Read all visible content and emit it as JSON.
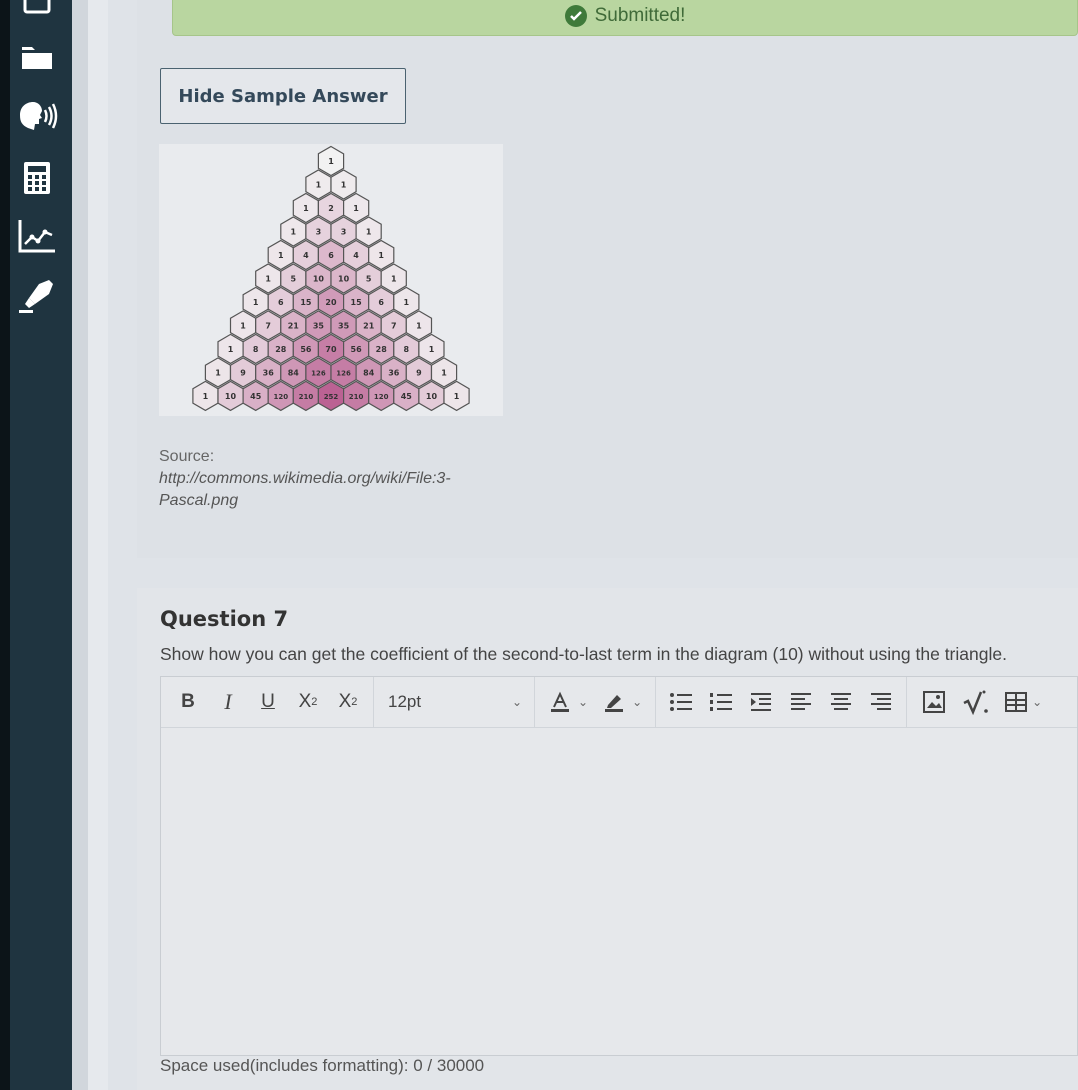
{
  "banner": {
    "text": "Submitted!",
    "icon": "check-circle-icon"
  },
  "sample": {
    "hide_button": "Hide Sample Answer",
    "triangle_rows": [
      [
        "1"
      ],
      [
        "1",
        "1"
      ],
      [
        "1",
        "2",
        "1"
      ],
      [
        "1",
        "3",
        "3",
        "1"
      ],
      [
        "1",
        "4",
        "6",
        "4",
        "1"
      ],
      [
        "1",
        "5",
        "10",
        "10",
        "5",
        "1"
      ],
      [
        "1",
        "6",
        "15",
        "20",
        "15",
        "6",
        "1"
      ],
      [
        "1",
        "7",
        "21",
        "35",
        "35",
        "21",
        "7",
        "1"
      ],
      [
        "1",
        "8",
        "28",
        "56",
        "70",
        "56",
        "28",
        "8",
        "1"
      ],
      [
        "1",
        "9",
        "36",
        "84",
        "126",
        "126",
        "84",
        "36",
        "9",
        "1"
      ],
      [
        "1",
        "10",
        "45",
        "120",
        "210",
        "252",
        "210",
        "120",
        "45",
        "10",
        "1"
      ]
    ],
    "source_label": "Source:",
    "source_url_line1": "http://commons.wikimedia.org/wiki/File:3-",
    "source_url_line2": "Pascal.png"
  },
  "question": {
    "title": "Question 7",
    "text": "Show how you can get the coefficient of the second-to-last term in the diagram (10) without using the triangle."
  },
  "editor": {
    "bold": "B",
    "italic": "I",
    "underline": "U",
    "superscript": "X",
    "superscript_mark": "2",
    "subscript": "X",
    "subscript_mark": "2",
    "font_size": "12pt",
    "value": ""
  },
  "footer": {
    "space_used": "Space used(includes formatting): 0 / 30000"
  },
  "colors": {
    "sidebar": "#1f3440",
    "banner": "#b9d6a0",
    "hex_light": "#f2f2f2",
    "hex_dark": "#b85a8e"
  }
}
